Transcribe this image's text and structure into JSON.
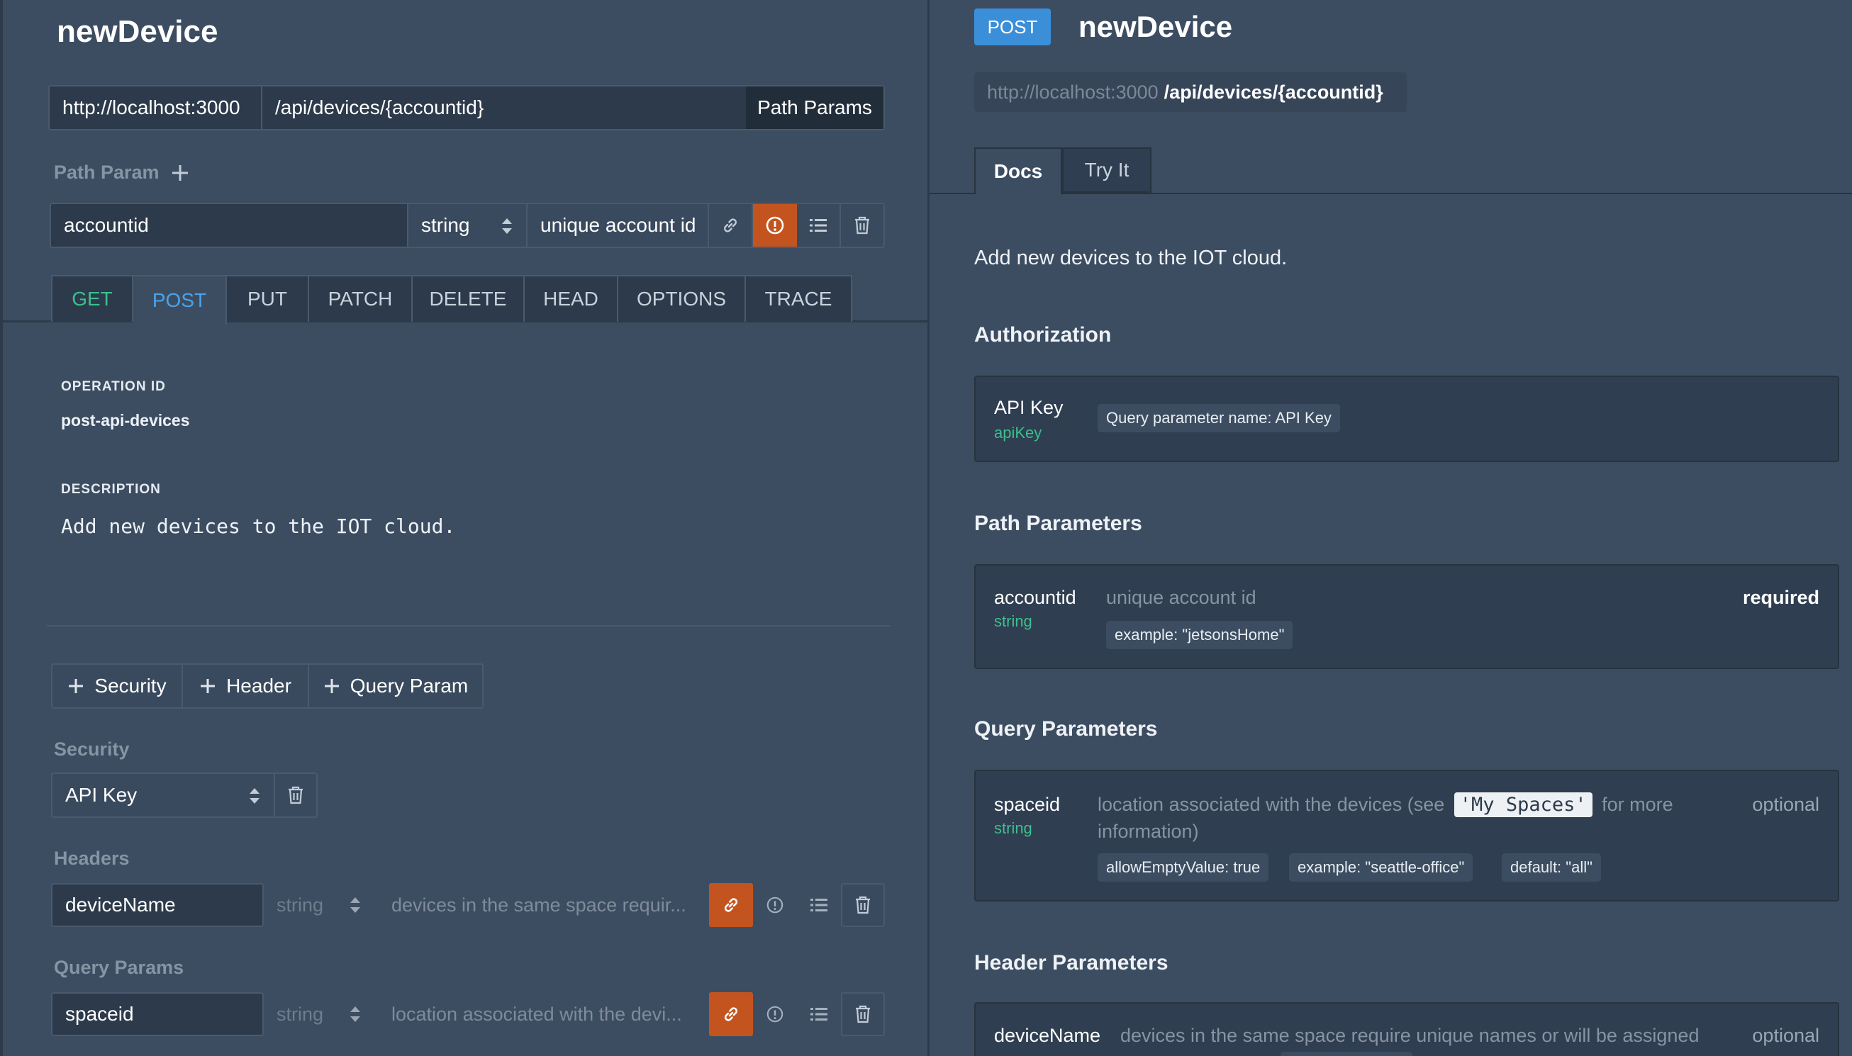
{
  "editor": {
    "title": "newDevice",
    "server": "http://localhost:3000",
    "path": "/api/devices/{accountid}",
    "path_params_button": "Path Params",
    "path_param_section": "Path Param",
    "path_param": {
      "name": "accountid",
      "type": "string",
      "description": "unique account id"
    },
    "methods": [
      "GET",
      "POST",
      "PUT",
      "PATCH",
      "DELETE",
      "HEAD",
      "OPTIONS",
      "TRACE"
    ],
    "operation_id_label": "OPERATION ID",
    "operation_id": "post-api-devices",
    "description_label": "DESCRIPTION",
    "description": "Add new devices to the IOT cloud.",
    "add_buttons": [
      "Security",
      "Header",
      "Query Param"
    ],
    "security_label": "Security",
    "security_value": "API Key",
    "headers_label": "Headers",
    "header": {
      "name": "deviceName",
      "type": "string",
      "description": "devices in the same space requir..."
    },
    "query_params_label": "Query Params",
    "query": {
      "name": "spaceid",
      "type": "string",
      "description": "location associated with the devi..."
    }
  },
  "docs": {
    "method_badge": "POST",
    "title": "newDevice",
    "server": "http://localhost:3000",
    "path": "/api/devices/{accountid}",
    "tabs": [
      "Docs",
      "Try It"
    ],
    "summary": "Add new devices to the IOT cloud.",
    "authorization": {
      "heading": "Authorization",
      "name": "API Key",
      "key": "apiKey",
      "chip": "Query parameter name: API Key"
    },
    "path_parameters": {
      "heading": "Path Parameters",
      "name": "accountid",
      "type": "string",
      "description": "unique account id",
      "required": "required",
      "example": "example: \"jetsonsHome\""
    },
    "query_parameters": {
      "heading": "Query Parameters",
      "name": "spaceid",
      "type": "string",
      "desc_before": "location associated with the devices (see",
      "code": "'My Spaces'",
      "desc_after": "for more",
      "desc_line2": "information)",
      "optional": "optional",
      "chips": [
        "allowEmptyValue: true",
        "example: \"seattle-office\"",
        "default: \"all\""
      ]
    },
    "header_parameters": {
      "heading": "Header Parameters",
      "name": "deviceName",
      "description": "devices in the same space require unique names or will be assigned",
      "optional": "optional"
    }
  },
  "colors": {
    "background": "#3c4d62",
    "input_bg": "#2c3a4b",
    "get_green": "#3cc08c",
    "post_blue": "#4aa3ea",
    "badge_blue": "#3b8fd8",
    "alert_orange": "#c4541f"
  },
  "icons": [
    "plus-icon",
    "sort-arrows-icon",
    "link-icon",
    "alert-circle-icon",
    "list-icon",
    "trash-icon"
  ]
}
